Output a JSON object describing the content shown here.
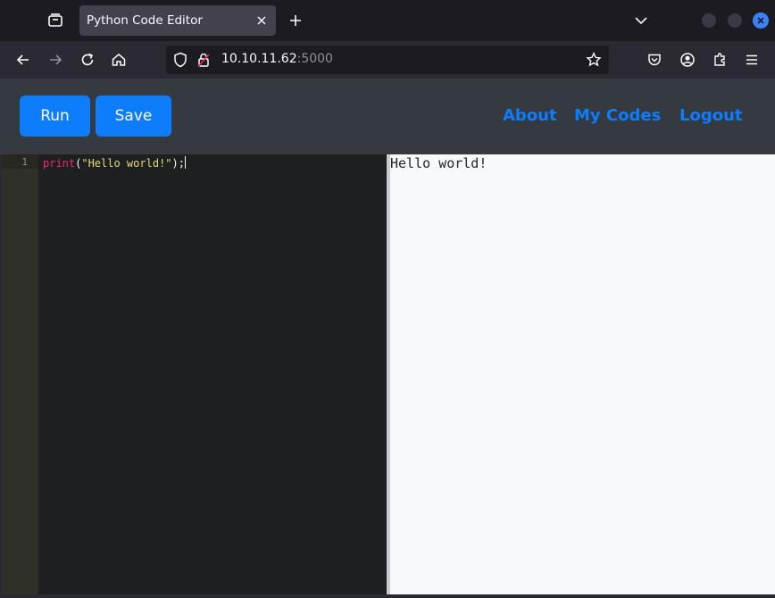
{
  "browser": {
    "tab_title": "Python Code Editor",
    "url_host": "10.10.11.62",
    "url_port": ":5000"
  },
  "header": {
    "run_label": "Run",
    "save_label": "Save",
    "links": [
      "About",
      "My Codes",
      "Logout"
    ],
    "accent_color": "#0d7dfb"
  },
  "editor": {
    "line_number": "1",
    "code": {
      "fn": "print",
      "open": "(",
      "string": "\"Hello world!\"",
      "close": ");"
    }
  },
  "output": {
    "text": "Hello world!"
  },
  "icons": [
    "tab-manager-icon",
    "close-icon",
    "plus-icon",
    "chevron-down-icon",
    "back-arrow-icon",
    "forward-arrow-icon",
    "reload-icon",
    "home-icon",
    "shield-icon",
    "lock-icon",
    "star-icon",
    "pocket-icon",
    "account-icon",
    "extensions-icon",
    "menu-icon"
  ]
}
